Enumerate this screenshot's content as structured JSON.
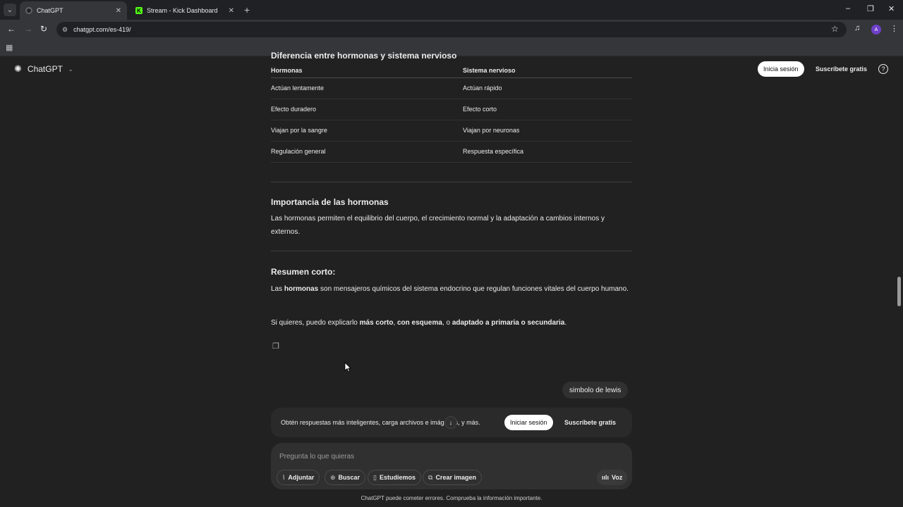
{
  "browser": {
    "tabs": [
      {
        "title": "ChatGPT",
        "active": true
      },
      {
        "title": "Stream - Kick Dashboard",
        "active": false
      }
    ],
    "new_tab": "+",
    "url": "chatgpt.com/es-419/",
    "avatar_letter": "A",
    "window_controls": [
      "–",
      "❐",
      "✕"
    ]
  },
  "header": {
    "brand": "ChatGPT",
    "login": "Inicia sesión",
    "signup": "Suscríbete gratis",
    "help": "?"
  },
  "content": {
    "cut_heading": "Diferencia entre hormonas y sistema nervioso",
    "table": {
      "headers": [
        "Hormonas",
        "Sistema nervioso"
      ],
      "rows": [
        [
          "Actúan lentamente",
          "Actúan rápido"
        ],
        [
          "Efecto duradero",
          "Efecto corto"
        ],
        [
          "Viajan por la sangre",
          "Viajan por neuronas"
        ],
        [
          "Regulación general",
          "Respuesta específica"
        ]
      ]
    },
    "importance_heading": "Importancia de las hormonas",
    "importance_text": "Las hormonas permiten el equilibrio del cuerpo, el crecimiento normal y la adaptación a cambios internos y externos.",
    "summary_heading": "Resumen corto:",
    "summary": {
      "p1_a": "Las ",
      "p1_b": "hormonas",
      "p1_c": " son mensajeros químicos del sistema endocrino que regulan funciones vitales del cuerpo humano.",
      "p2_a": "Si quieres, puedo explicarlo ",
      "p2_b": "más corto",
      "p2_c": ", ",
      "p2_d": "con esquema",
      "p2_e": ", o ",
      "p2_f": "adaptado a primaria o secundaria",
      "p2_g": "."
    }
  },
  "user_message": "simbolo de lewis",
  "banner": {
    "text": "Obtén respuestas más inteligentes, carga archivos e imágenes, y más.",
    "login": "Iniciar sesión",
    "signup": "Suscríbete gratis"
  },
  "composer": {
    "placeholder": "Pregunta lo que quieras",
    "chips": [
      "Adjuntar",
      "Buscar",
      "Estudiemos",
      "Crear imagen"
    ],
    "voice": "Voz"
  },
  "disclaimer": "ChatGPT puede cometer errores. Comprueba la información importante."
}
